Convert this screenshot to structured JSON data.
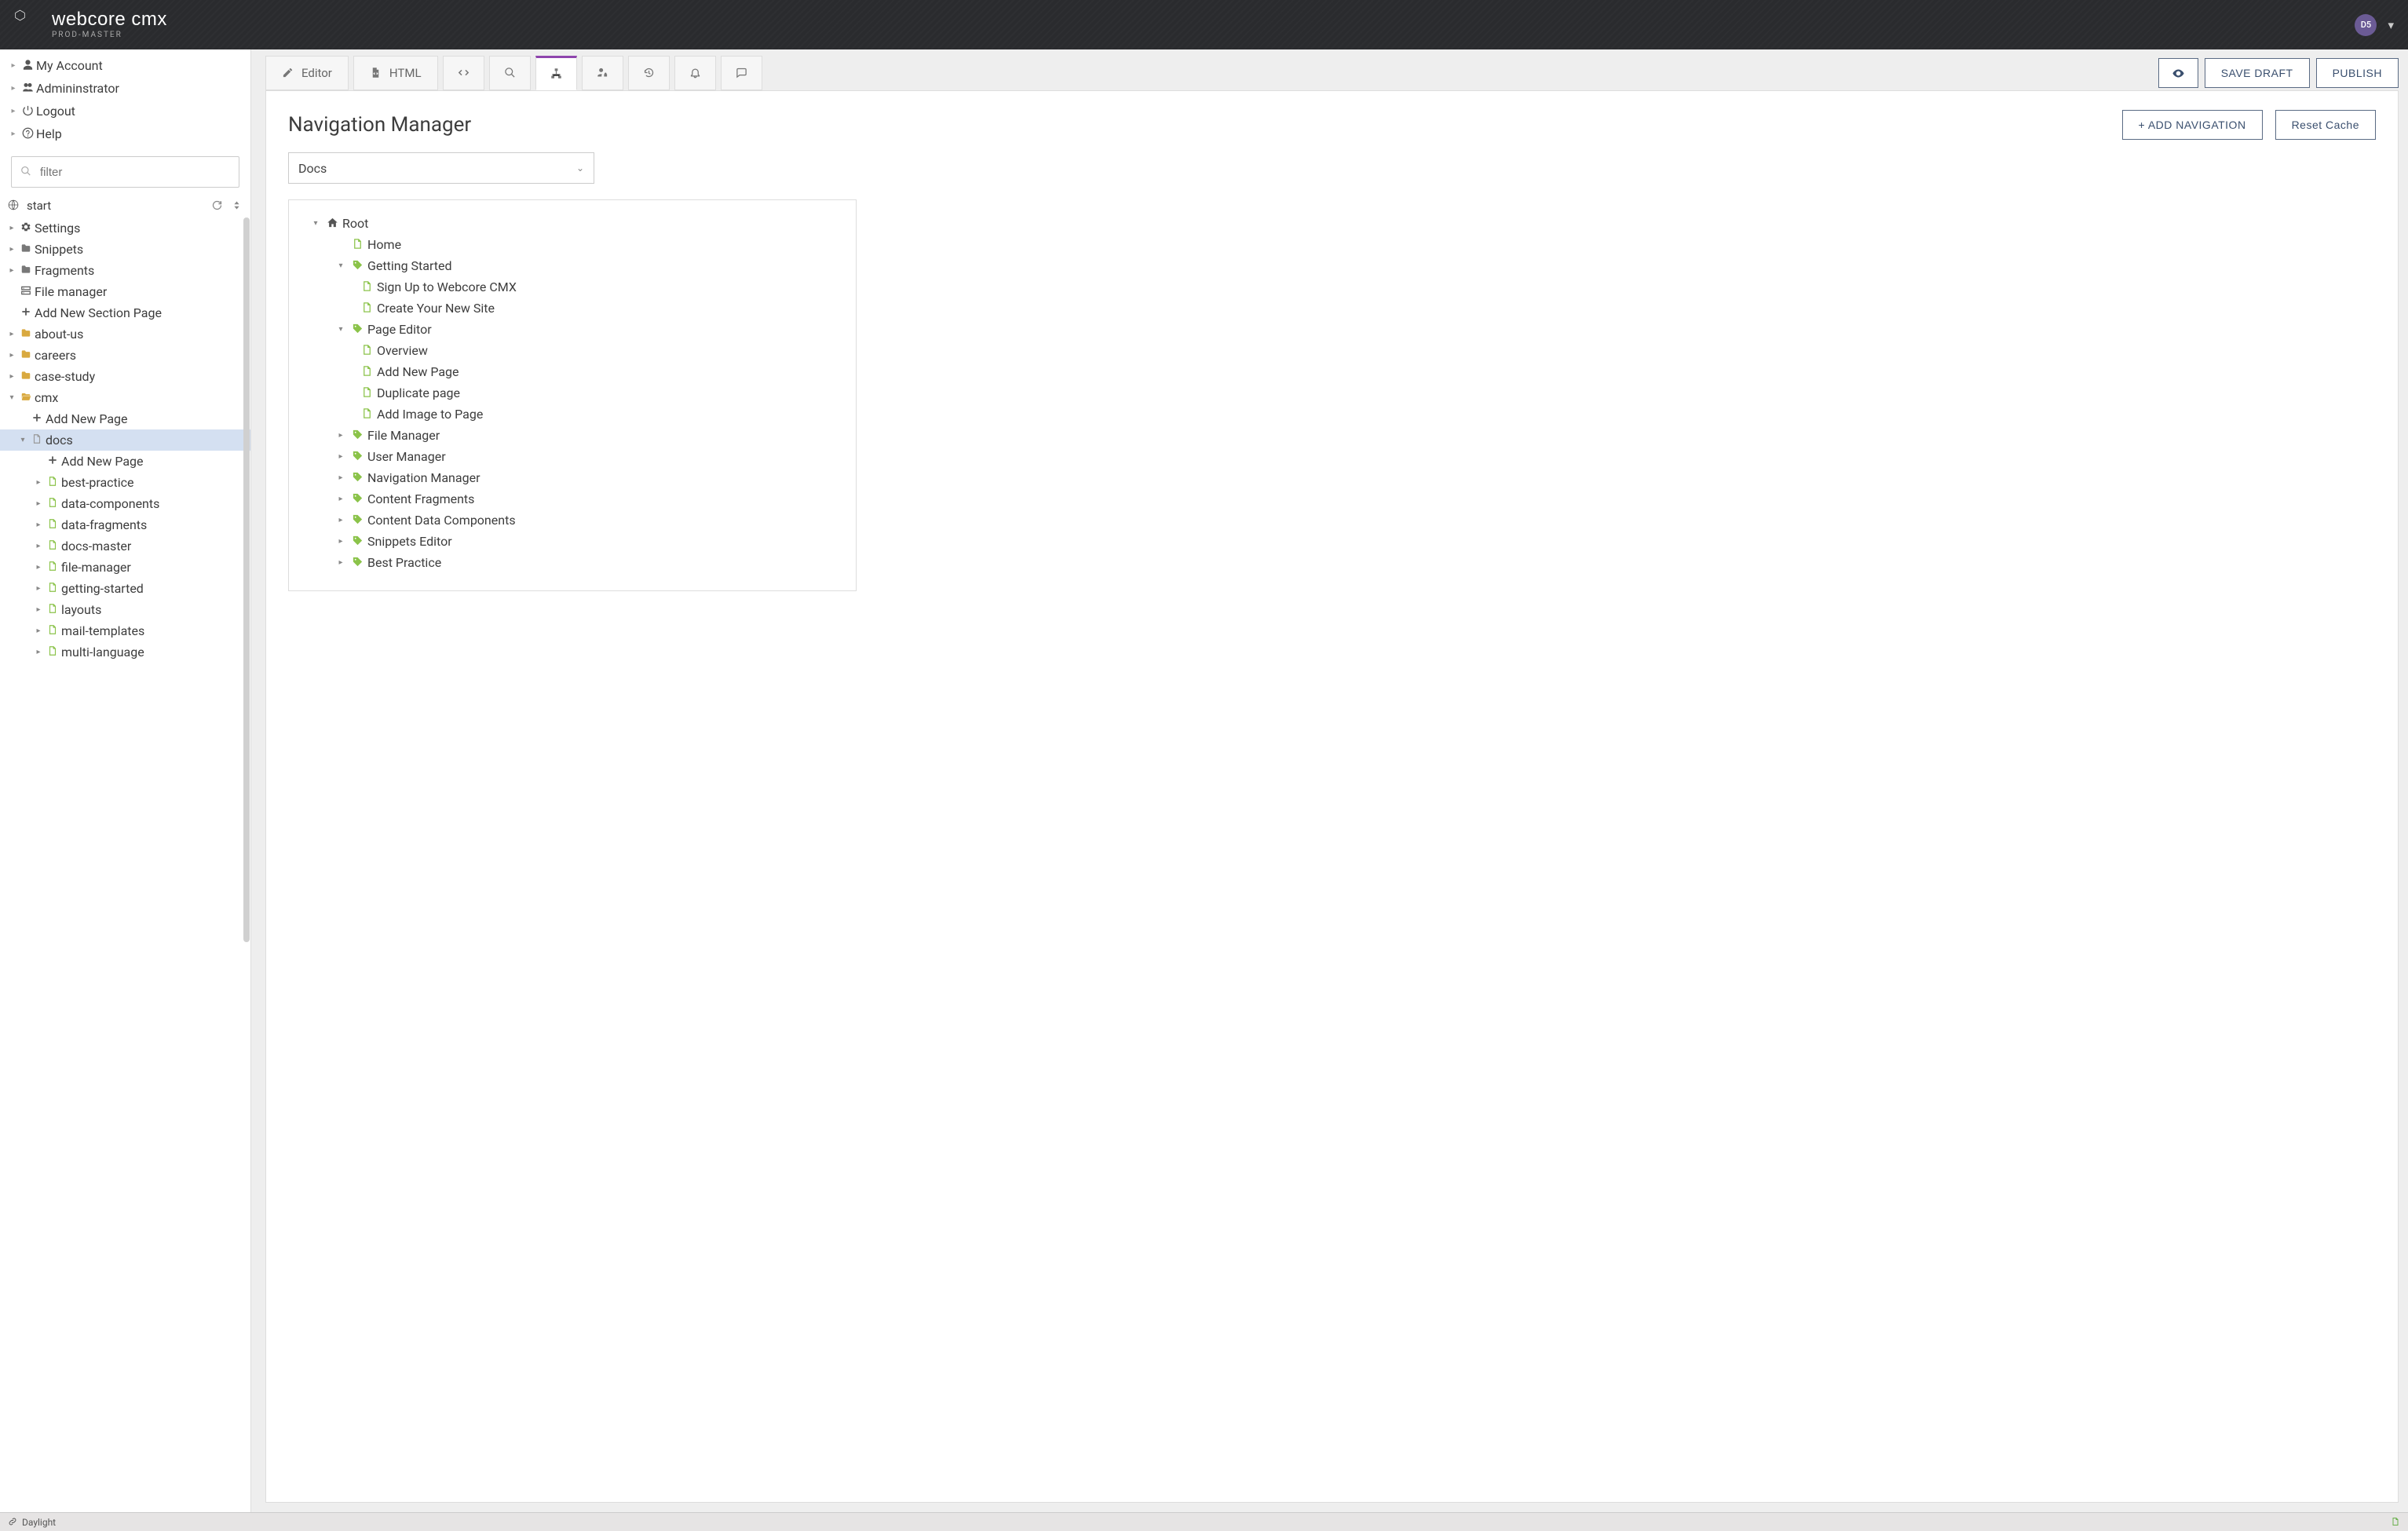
{
  "brand": {
    "name": "webcore cmx",
    "sub": "PROD-MASTER"
  },
  "user": {
    "avatar_initials": "D5"
  },
  "sidebar_top": [
    {
      "icon": "user",
      "label": "My Account"
    },
    {
      "icon": "users",
      "label": "Admininstrator"
    },
    {
      "icon": "power",
      "label": "Logout"
    },
    {
      "icon": "help",
      "label": "Help"
    }
  ],
  "filter_placeholder": "filter",
  "start_label": "start",
  "sidebar_tree": [
    {
      "indent": 1,
      "expander": "right",
      "icon": "gear",
      "icon_cls": "gear",
      "label": "Settings"
    },
    {
      "indent": 1,
      "expander": "right",
      "icon": "folder",
      "icon_cls": "folder-gray",
      "label": "Snippets"
    },
    {
      "indent": 1,
      "expander": "right",
      "icon": "folder",
      "icon_cls": "folder-gray",
      "label": "Fragments"
    },
    {
      "indent": 1,
      "expander": "",
      "icon": "db",
      "icon_cls": "db",
      "label": "File manager"
    },
    {
      "indent": 1,
      "expander": "",
      "icon": "plus",
      "icon_cls": "plus",
      "label": "Add New Section Page"
    },
    {
      "indent": 1,
      "expander": "right",
      "icon": "folder",
      "icon_cls": "folder-yellow",
      "label": "about-us"
    },
    {
      "indent": 1,
      "expander": "right",
      "icon": "folder",
      "icon_cls": "folder-yellow",
      "label": "careers"
    },
    {
      "indent": 1,
      "expander": "right",
      "icon": "folder",
      "icon_cls": "folder-yellow",
      "label": "case-study"
    },
    {
      "indent": 1,
      "expander": "down",
      "icon": "folder-open",
      "icon_cls": "folder-open",
      "label": "cmx"
    },
    {
      "indent": 2,
      "expander": "",
      "icon": "plus",
      "icon_cls": "plus",
      "label": "Add New Page"
    },
    {
      "indent": 2,
      "expander": "down",
      "icon": "page",
      "icon_cls": "page-gray",
      "label": "docs",
      "selected": true
    },
    {
      "indent": 3,
      "expander": "",
      "icon": "plus",
      "icon_cls": "plus",
      "label": "Add New Page"
    },
    {
      "indent": 3,
      "expander": "right",
      "icon": "page",
      "icon_cls": "page-green",
      "label": "best-practice"
    },
    {
      "indent": 3,
      "expander": "right",
      "icon": "page",
      "icon_cls": "page-green",
      "label": "data-components"
    },
    {
      "indent": 3,
      "expander": "right",
      "icon": "page",
      "icon_cls": "page-green",
      "label": "data-fragments"
    },
    {
      "indent": 3,
      "expander": "right",
      "icon": "page",
      "icon_cls": "page-green",
      "label": "docs-master"
    },
    {
      "indent": 3,
      "expander": "right",
      "icon": "page",
      "icon_cls": "page-green",
      "label": "file-manager"
    },
    {
      "indent": 3,
      "expander": "right",
      "icon": "page",
      "icon_cls": "page-green",
      "label": "getting-started"
    },
    {
      "indent": 3,
      "expander": "right",
      "icon": "page",
      "icon_cls": "page-green",
      "label": "layouts"
    },
    {
      "indent": 3,
      "expander": "right",
      "icon": "page",
      "icon_cls": "page-green",
      "label": "mail-templates"
    },
    {
      "indent": 3,
      "expander": "right",
      "icon": "page",
      "icon_cls": "page-green",
      "label": "multi-language"
    }
  ],
  "tabs": [
    {
      "icon": "edit",
      "label": "Editor"
    },
    {
      "icon": "filecode",
      "label": "HTML"
    },
    {
      "icon": "code",
      "label": ""
    },
    {
      "icon": "search",
      "label": ""
    },
    {
      "icon": "sitemap",
      "label": "",
      "active": true
    },
    {
      "icon": "userlock",
      "label": ""
    },
    {
      "icon": "history",
      "label": ""
    },
    {
      "icon": "bell",
      "label": ""
    },
    {
      "icon": "comment",
      "label": ""
    }
  ],
  "action_buttons": {
    "preview_icon": "eye",
    "save_draft": "SAVE DRAFT",
    "publish": "PUBLISH"
  },
  "panel_title": "Navigation Manager",
  "panel_buttons": {
    "add_nav": "+ ADD NAVIGATION",
    "reset_cache": "Reset Cache"
  },
  "nav_select_value": "Docs",
  "nav_tree": [
    {
      "indent": 1,
      "expander": "down",
      "icon": "home",
      "icon_cls": "home",
      "label": "Root"
    },
    {
      "indent": 2,
      "expander": "",
      "icon": "page",
      "icon_cls": "page",
      "label": "Home"
    },
    {
      "indent": 2,
      "expander": "down",
      "icon": "tag",
      "icon_cls": "tag",
      "label": "Getting Started"
    },
    {
      "indent": 3,
      "expander": "",
      "icon": "page",
      "icon_cls": "page",
      "label": "Sign Up to Webcore CMX"
    },
    {
      "indent": 3,
      "expander": "",
      "icon": "page",
      "icon_cls": "page",
      "label": "Create Your New Site"
    },
    {
      "indent": 2,
      "expander": "down",
      "icon": "tag",
      "icon_cls": "tag",
      "label": "Page Editor"
    },
    {
      "indent": 3,
      "expander": "",
      "icon": "page",
      "icon_cls": "page",
      "label": "Overview"
    },
    {
      "indent": 3,
      "expander": "",
      "icon": "page",
      "icon_cls": "page",
      "label": "Add New Page"
    },
    {
      "indent": 3,
      "expander": "",
      "icon": "page",
      "icon_cls": "page",
      "label": "Duplicate page"
    },
    {
      "indent": 3,
      "expander": "",
      "icon": "page",
      "icon_cls": "page",
      "label": "Add Image to Page"
    },
    {
      "indent": 2,
      "expander": "right",
      "icon": "tag",
      "icon_cls": "tag",
      "label": "File Manager"
    },
    {
      "indent": 2,
      "expander": "right",
      "icon": "tag",
      "icon_cls": "tag",
      "label": "User Manager"
    },
    {
      "indent": 2,
      "expander": "right",
      "icon": "tag",
      "icon_cls": "tag",
      "label": "Navigation Manager"
    },
    {
      "indent": 2,
      "expander": "right",
      "icon": "tag",
      "icon_cls": "tag",
      "label": "Content Fragments"
    },
    {
      "indent": 2,
      "expander": "right",
      "icon": "tag",
      "icon_cls": "tag",
      "label": "Content Data Components"
    },
    {
      "indent": 2,
      "expander": "right",
      "icon": "tag",
      "icon_cls": "tag",
      "label": "Snippets Editor"
    },
    {
      "indent": 2,
      "expander": "right",
      "icon": "tag",
      "icon_cls": "tag",
      "label": "Best Practice"
    }
  ],
  "statusbar": {
    "theme": "Daylight"
  }
}
